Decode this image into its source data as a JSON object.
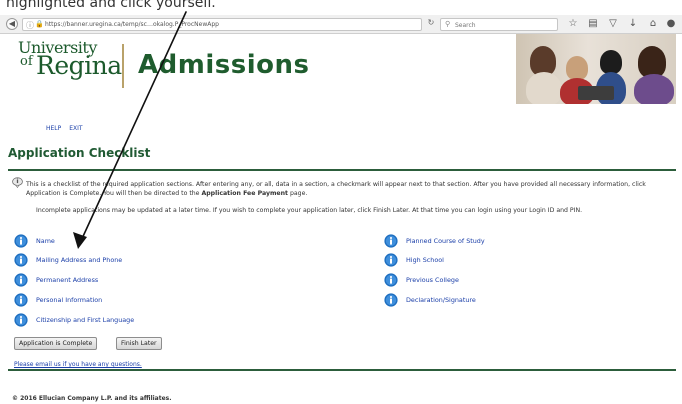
{
  "browser": {
    "url": "https://banner.uregina.ca/temp/sc…okalog.P_ProcNewApp",
    "search_placeholder": "Search"
  },
  "header": {
    "logo_line1": "University",
    "logo_line2": "of",
    "logo_line3": "Regina",
    "site_title": "Admissions",
    "links": {
      "help": "HELP",
      "exit": "EXIT"
    }
  },
  "page": {
    "title": "Application Checklist",
    "info_part1": "This is a checklist of the required application sections. After entering any, or all, data in a section, a checkmark will appear next to that section. After you have provided all necessary information, click Application is Complete. You will then be directed to the ",
    "info_bold": "Application Fee Payment",
    "info_part2": " page.",
    "info_line2": "Incomplete applications may be updated at a later time. If you wish to complete your application later, click Finish Later. At that time you can login using your Login ID and PIN."
  },
  "sections_left": [
    {
      "label": "Name"
    },
    {
      "label": "Mailing Address and Phone"
    },
    {
      "label": "Permanent Address"
    },
    {
      "label": "Personal Information"
    },
    {
      "label": "Citizenship and First Language"
    }
  ],
  "sections_right": [
    {
      "label": "Planned Course of Study"
    },
    {
      "label": "High School"
    },
    {
      "label": "Previous College"
    },
    {
      "label": "Declaration/Signature"
    }
  ],
  "buttons": {
    "complete": "Application is Complete",
    "finish_later": "Finish Later"
  },
  "footer": {
    "email_link": "Please email us if you have any questions.",
    "copyright": "© 2016 Ellucian Company L.P. and its affiliates."
  },
  "overlay": {
    "top_caption": "highlighted and click yourself."
  },
  "colors": {
    "brand_green": "#1f5c2e",
    "link_blue": "#1a3ea8",
    "icon_blue": "#1f6fc0"
  }
}
